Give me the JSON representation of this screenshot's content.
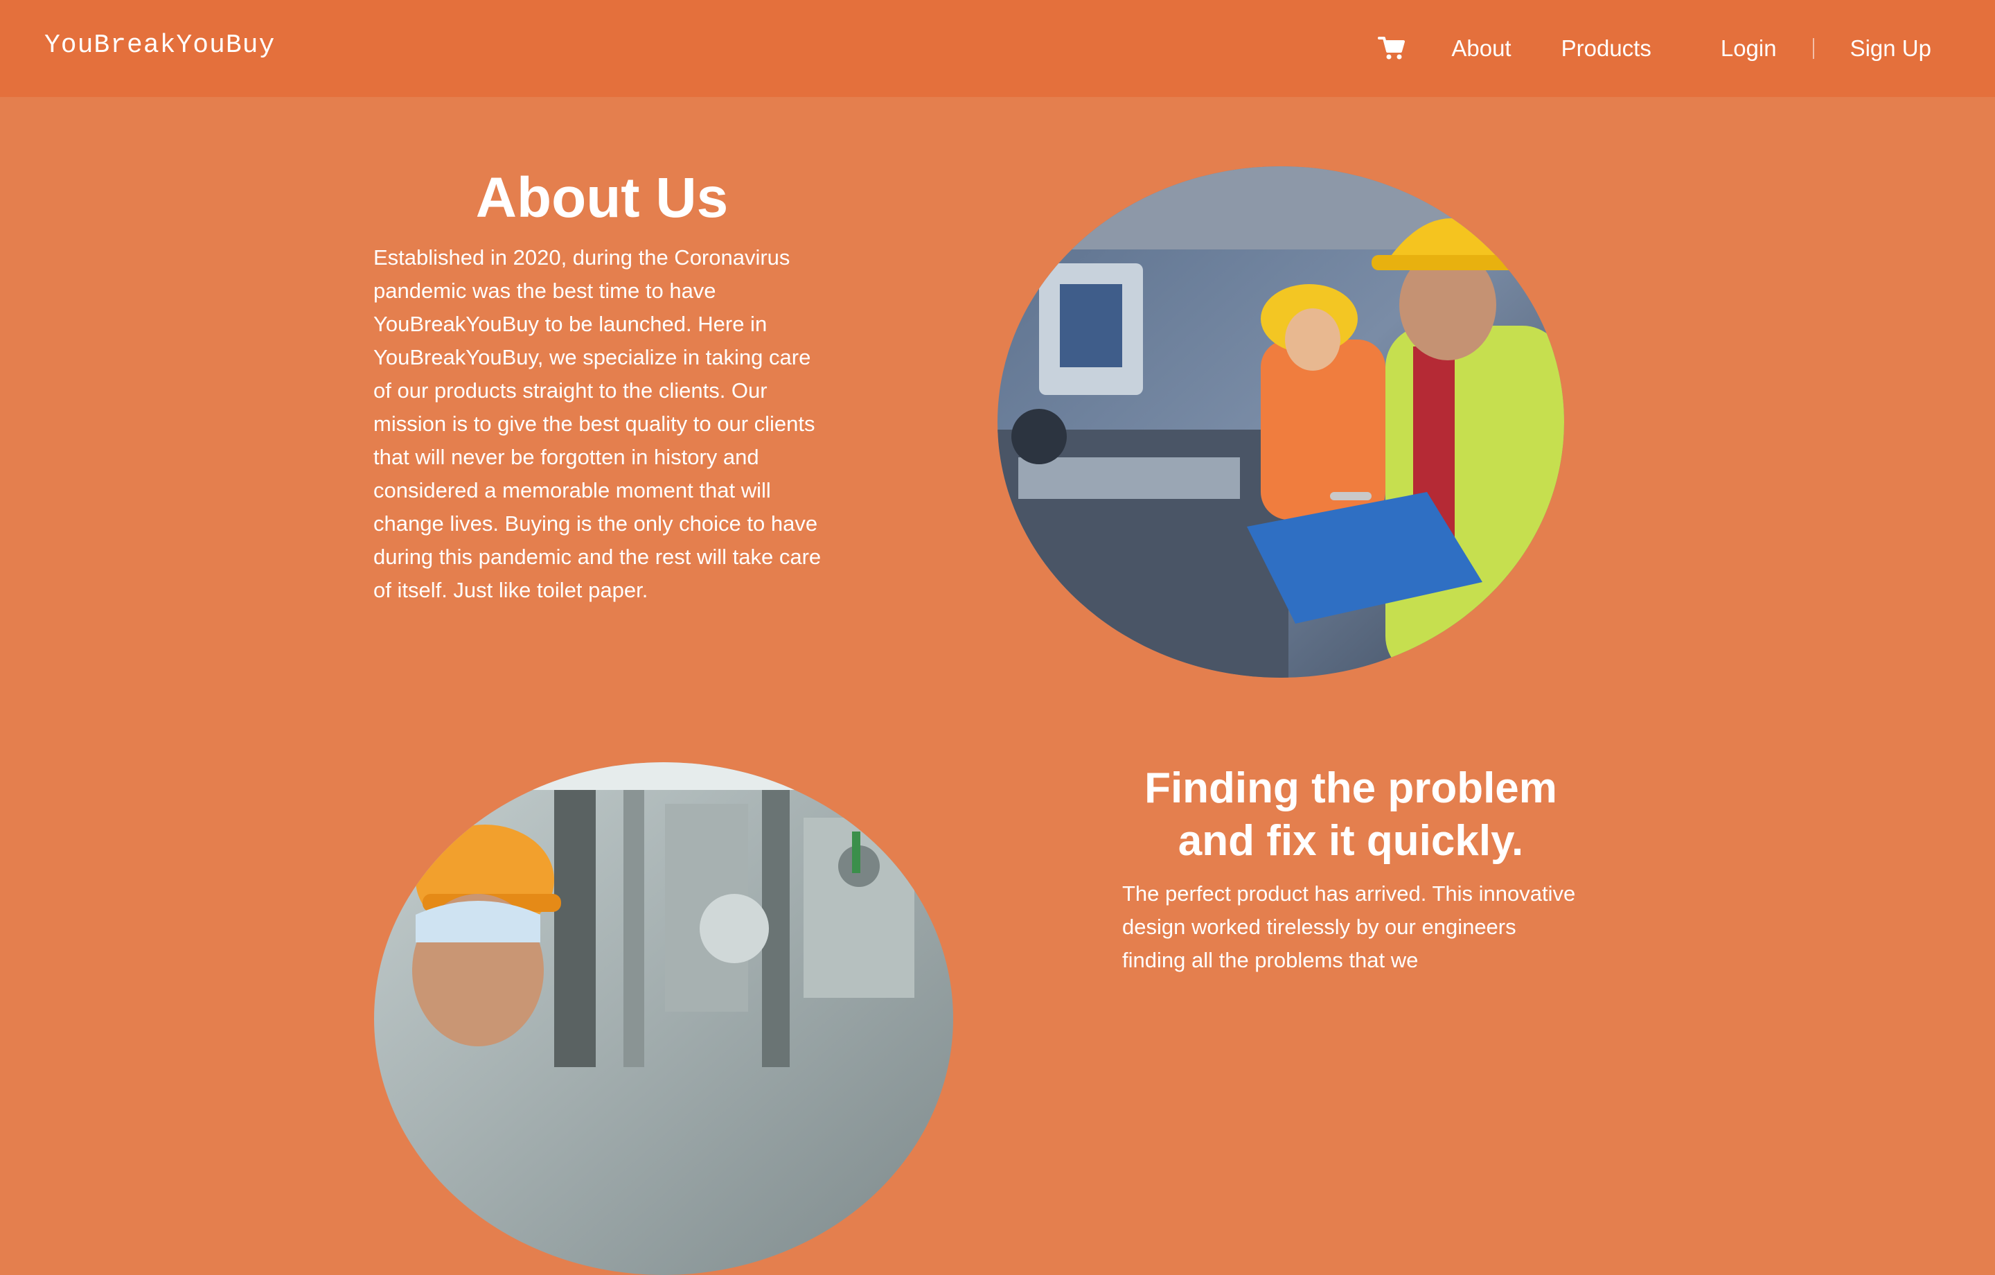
{
  "nav": {
    "brand": "YouBreakYouBuy",
    "cart_icon": "shopping-cart-icon",
    "about": "About",
    "products": "Products",
    "login": "Login",
    "signup": "Sign Up"
  },
  "about_section": {
    "title": "About Us",
    "body": "Established in 2020, during the Coronavirus pandemic was the best time to have YouBreakYouBuy to be launched. Here in YouBreakYouBuy, we specialize in taking care of our products straight to the clients. Our mission is to give the best quality to our clients that will never be forgotten in history and considered a memorable moment that will change lives. Buying is the only choice to have during this pandemic and the rest will take care of itself. Just like toilet paper."
  },
  "problem_section": {
    "title": "Finding the problem and fix it quickly.",
    "body": "The perfect product has arrived. This innovative design worked tirelessly by our engineers finding all the problems that we"
  },
  "colors": {
    "navbar": "#e4703c",
    "page_background": "#e47f4e",
    "text": "#ffffff"
  }
}
